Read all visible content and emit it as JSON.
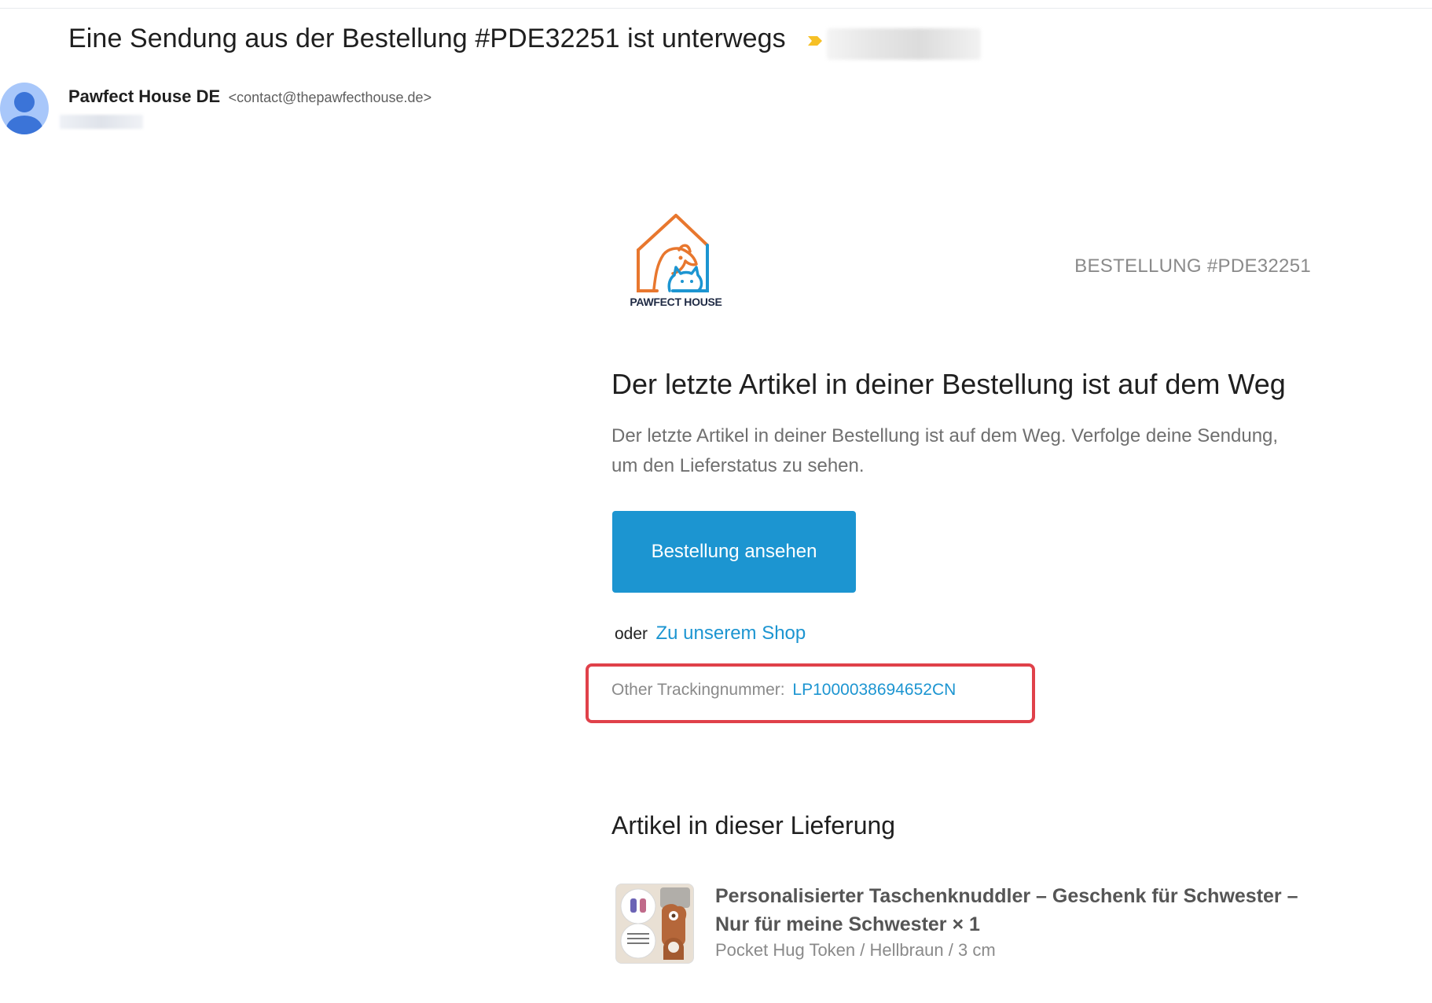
{
  "email": {
    "subject": "Eine Sendung aus der Bestellung #PDE32251 ist unterwegs",
    "sender_name": "Pawfect House DE",
    "sender_email": "<contact@thepawfecthouse.de>"
  },
  "brand": {
    "logo_text": "PAWFECT HOUSE",
    "accent_color": "#1c95d1",
    "highlight_color": "#e0414a"
  },
  "content": {
    "order_number": "BESTELLUNG #PDE32251",
    "headline": "Der letzte Artikel in deiner Bestellung ist auf dem Weg",
    "body": "Der letzte Artikel in deiner Bestellung ist auf dem Weg. Verfolge deine Sendung, um den Lieferstatus zu sehen.",
    "cta_label": "Bestellung ansehen",
    "or_word": "oder",
    "shop_link": "Zu unserem Shop",
    "tracking_label": "Other Trackingnummer:",
    "tracking_number": "LP1000038694652CN"
  },
  "items_section": {
    "title": "Artikel in dieser Lieferung",
    "items": [
      {
        "title": "Personalisierter Taschenknuddler – Geschenk für Schwester – Nur für meine Schwester × 1",
        "variant": "Pocket Hug Token / Hellbraun / 3 cm"
      }
    ]
  }
}
